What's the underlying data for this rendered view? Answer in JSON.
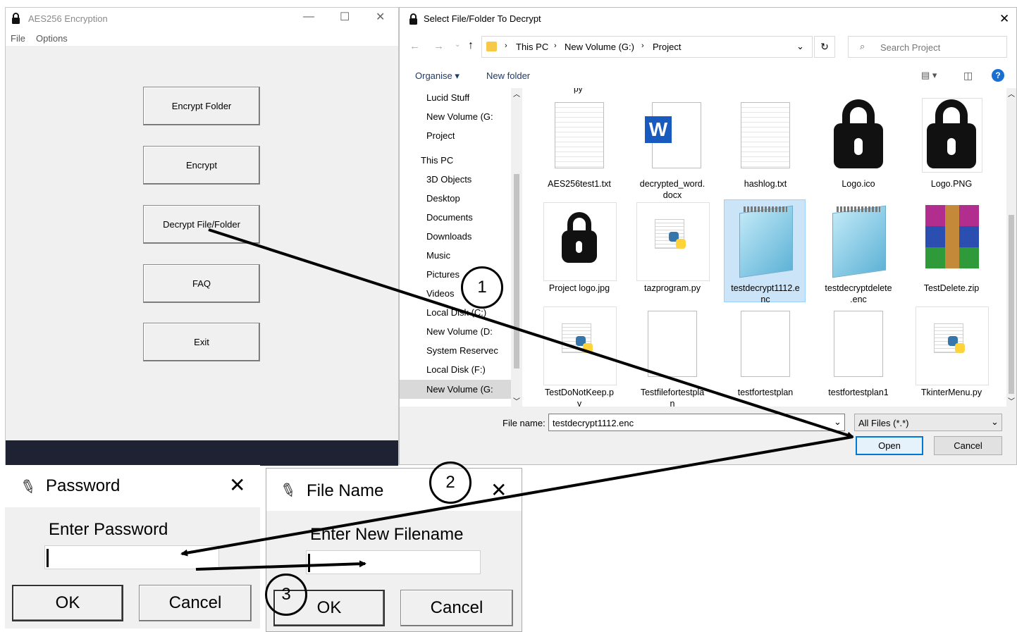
{
  "app": {
    "title": "AES256 Encryption",
    "menu": [
      "File",
      "Options"
    ],
    "buttons": {
      "encrypt_folder": "Encrypt Folder",
      "encrypt": "Encrypt",
      "decrypt": "Decrypt File/Folder",
      "faq": "FAQ",
      "exit": "Exit"
    },
    "window_controls": [
      "—",
      "☐",
      "✕"
    ]
  },
  "file_dialog": {
    "title": "Select File/Folder To Decrypt",
    "breadcrumb": [
      "This PC",
      "New Volume (G:)",
      "Project"
    ],
    "search_placeholder": "Search Project",
    "toolbar": {
      "organise": "Organise ▾",
      "new_folder": "New folder"
    },
    "nav_items": [
      "Lucid Stuff",
      "New Volume (G:",
      "Project",
      "This PC",
      "3D Objects",
      "Desktop",
      "Documents",
      "Downloads",
      "Music",
      "Pictures",
      "Videos",
      "Local Disk (C:)",
      "New Volume (D:",
      "System Reservec",
      "Local Disk (F:)",
      "New Volume (G:"
    ],
    "files": [
      {
        "name": "AES256test1.txt",
        "icon": "text-doc"
      },
      {
        "name": "decrypted_word.\ndocx",
        "icon": "word-doc"
      },
      {
        "name": "hashlog.txt",
        "icon": "text-doc"
      },
      {
        "name": "Logo.ico",
        "icon": "lock"
      },
      {
        "name": "Logo.PNG",
        "icon": "lock"
      },
      {
        "name": "Project logo.jpg",
        "icon": "lock"
      },
      {
        "name": "tazprogram.py",
        "icon": "python"
      },
      {
        "name": "testdecrypt1112.e\nnc",
        "icon": "notepad"
      },
      {
        "name": "testdecryptdelete\n.enc",
        "icon": "notepad"
      },
      {
        "name": "TestDelete.zip",
        "icon": "zip"
      },
      {
        "name": "TestDoNotKeep.p\ny",
        "icon": "python"
      },
      {
        "name": "Testfilefortestpla\nn",
        "icon": "blank"
      },
      {
        "name": "testfortestplan",
        "icon": "blank"
      },
      {
        "name": "testfortestplan1",
        "icon": "blank"
      },
      {
        "name": "TkinterMenu.py",
        "icon": "python"
      }
    ],
    "top_row_partial": [
      "py",
      "",
      "",
      "",
      ""
    ],
    "filename_label": "File name:",
    "filename_value": "testdecrypt1112.enc",
    "filetype": "All Files (*.*)",
    "open": "Open",
    "cancel": "Cancel",
    "close": "✕"
  },
  "password_dialog": {
    "title": "Password",
    "prompt": "Enter Password",
    "ok": "OK",
    "cancel": "Cancel",
    "close": "✕"
  },
  "filename_dialog": {
    "title": "File Name",
    "prompt": "Enter New Filename",
    "ok": "OK",
    "cancel": "Cancel",
    "close": "✕"
  },
  "annotations": [
    "1",
    "2",
    "3"
  ]
}
